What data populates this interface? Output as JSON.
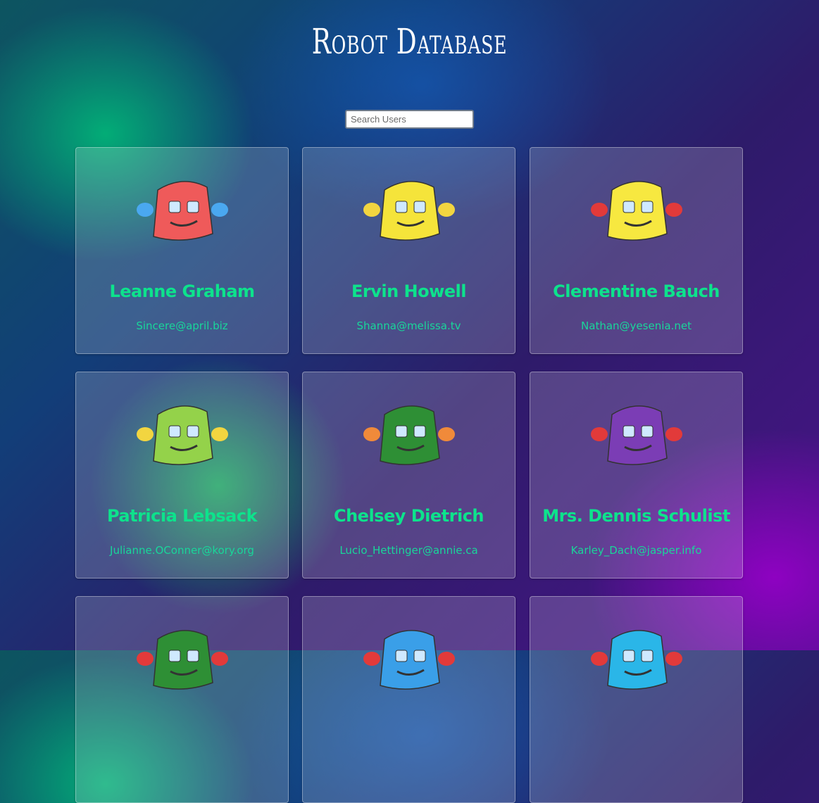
{
  "app": {
    "title": "Robot Database"
  },
  "search": {
    "placeholder": "Search Users",
    "value": ""
  },
  "robots": [
    {
      "name": "Leanne Graham",
      "email": "Sincere@april.biz",
      "color": "#ef5a5a",
      "ear": "#4aa8f0"
    },
    {
      "name": "Ervin Howell",
      "email": "Shanna@melissa.tv",
      "color": "#f5e43a",
      "ear": "#f2d540"
    },
    {
      "name": "Clementine Bauch",
      "email": "Nathan@yesenia.net",
      "color": "#f7e840",
      "ear": "#e23a3a"
    },
    {
      "name": "Patricia Lebsack",
      "email": "Julianne.OConner@kory.org",
      "color": "#94d24a",
      "ear": "#f2d540"
    },
    {
      "name": "Chelsey Dietrich",
      "email": "Lucio_Hettinger@annie.ca",
      "color": "#2e8f35",
      "ear": "#f08a3a"
    },
    {
      "name": "Mrs. Dennis Schulist",
      "email": "Karley_Dach@jasper.info",
      "color": "#7b3db5",
      "ear": "#e23a3a"
    },
    {
      "name": "",
      "email": "",
      "color": "#2e8f35",
      "ear": "#e23a3a"
    },
    {
      "name": "",
      "email": "",
      "color": "#3a9fe8",
      "ear": "#e23a3a"
    },
    {
      "name": "",
      "email": "",
      "color": "#2ab6e8",
      "ear": "#e23a3a"
    }
  ]
}
